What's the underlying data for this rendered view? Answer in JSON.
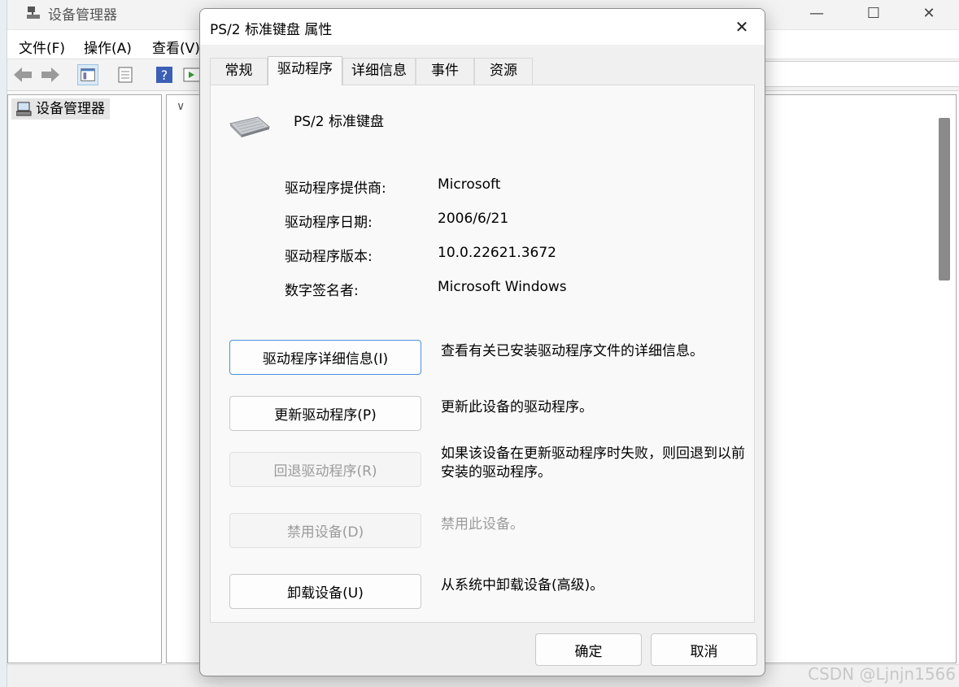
{
  "background_window": {
    "title": "设备管理器",
    "menu": [
      "文件(F)",
      "操作(A)",
      "查看(V)"
    ],
    "tree_root": "设备管理器"
  },
  "dialog": {
    "title": "PS/2 标准键盘 属性",
    "tabs": [
      {
        "label": "常规",
        "active": false
      },
      {
        "label": "驱动程序",
        "active": true
      },
      {
        "label": "详细信息",
        "active": false
      },
      {
        "label": "事件",
        "active": false
      },
      {
        "label": "资源",
        "active": false
      }
    ],
    "device_name": "PS/2 标准键盘",
    "info": [
      {
        "label": "驱动程序提供商:",
        "value": "Microsoft"
      },
      {
        "label": "驱动程序日期:",
        "value": "2006/6/21"
      },
      {
        "label": "驱动程序版本:",
        "value": "10.0.22621.3672"
      },
      {
        "label": "数字签名者:",
        "value": "Microsoft Windows"
      }
    ],
    "actions": [
      {
        "button": "驱动程序详细信息(I)",
        "description": "查看有关已安装驱动程序文件的详细信息。",
        "enabled": true
      },
      {
        "button": "更新驱动程序(P)",
        "description": "更新此设备的驱动程序。",
        "enabled": true
      },
      {
        "button": "回退驱动程序(R)",
        "description": "如果该设备在更新驱动程序时失败，则回退到以前安装的驱动程序。",
        "enabled": false
      },
      {
        "button": "禁用设备(D)",
        "description": "禁用此设备。",
        "enabled": false
      },
      {
        "button": "卸载设备(U)",
        "description": "从系统中卸载设备(高级)。",
        "enabled": true
      }
    ],
    "ok_label": "确定",
    "cancel_label": "取消"
  },
  "watermark": "CSDN @Ljnjn1566",
  "colors": {
    "focus_border": "#4a90d9",
    "disabled_text": "#9b9b9b"
  }
}
